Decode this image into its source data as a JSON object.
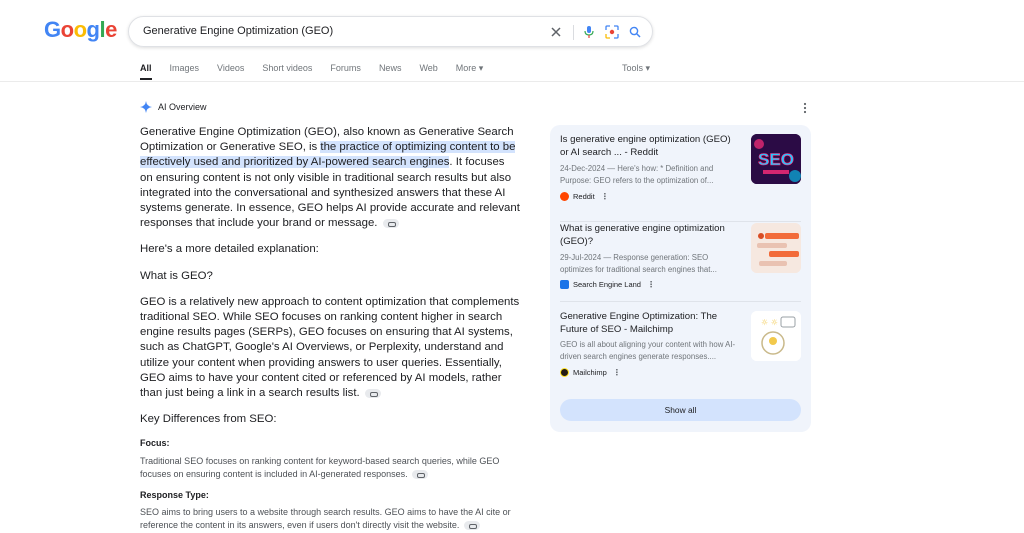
{
  "logo": {
    "letters": [
      {
        "ch": "G",
        "color": "#4285F4"
      },
      {
        "ch": "o",
        "color": "#EA4335"
      },
      {
        "ch": "o",
        "color": "#FBBC05"
      },
      {
        "ch": "g",
        "color": "#4285F4"
      },
      {
        "ch": "l",
        "color": "#34A853"
      },
      {
        "ch": "e",
        "color": "#EA4335"
      }
    ]
  },
  "search": {
    "query": "Generative Engine Optimization (GEO)",
    "icons": [
      "close-icon",
      "mic-icon",
      "lens-icon",
      "search-icon"
    ]
  },
  "tabs": [
    {
      "label": "All",
      "active": true
    },
    {
      "label": "Images"
    },
    {
      "label": "Videos"
    },
    {
      "label": "Short videos"
    },
    {
      "label": "Forums"
    },
    {
      "label": "News"
    },
    {
      "label": "Web"
    },
    {
      "label": "More ▾"
    }
  ],
  "tools_label": "Tools ▾",
  "ai_overview": {
    "label": "AI Overview",
    "intro_a": "Generative Engine Optimization (GEO), also known as Generative Search Optimization or Generative SEO, is ",
    "intro_highlight": "the practice of optimizing content to be effectively used and prioritized by AI-powered search engines",
    "intro_b": ". It focuses on ensuring content is not only visible in traditional search results but also integrated into the conversational and synthesized answers that these AI systems generate. In essence, GEO helps AI provide accurate and relevant responses that include your brand or message.",
    "detail_intro": "Here's a more detailed explanation:",
    "what_heading": "What is GEO?",
    "what_body": "GEO is a relatively new approach to content optimization that complements traditional SEO. While SEO focuses on ranking content higher in search engine results pages (SERPs), GEO focuses on ensuring that AI systems, such as ChatGPT, Google's AI Overviews, or Perplexity, understand and utilize your content when providing answers to user queries. Essentially, GEO aims to have your content cited or referenced by AI models, rather than just being a link in a search results list.",
    "diff_heading": "Key Differences from SEO:",
    "focus_label": "Focus:",
    "focus_body": "Traditional SEO focuses on ranking content for keyword-based search queries, while GEO focuses on ensuring content is included in AI-generated responses.",
    "response_label": "Response Type:",
    "response_body": "SEO aims to bring users to a website through search results. GEO aims to have the AI cite or reference the content in its answers, even if users don't directly visit the website."
  },
  "sources": [
    {
      "title": "Is generative engine optimization (GEO) or AI search ... - Reddit",
      "snippet": "24-Dec-2024 — Here's how: * Definition and Purpose: GEO refers to the optimization of...",
      "site": "Reddit",
      "fav_color": "#FF4500",
      "thumb_text": "SEO"
    },
    {
      "title": "What is generative engine optimization (GEO)?",
      "snippet": "29-Jul-2024 — Response generation: SEO optimizes for traditional search engines that...",
      "site": "Search Engine Land",
      "fav_color": "#1a73e8"
    },
    {
      "title": "Generative Engine Optimization: The Future of SEO - Mailchimp",
      "snippet": "GEO is all about aligning your content with how AI-driven search engines generate responses....",
      "site": "Mailchimp",
      "fav_color": "#241C15"
    }
  ],
  "show_all_label": "Show all"
}
